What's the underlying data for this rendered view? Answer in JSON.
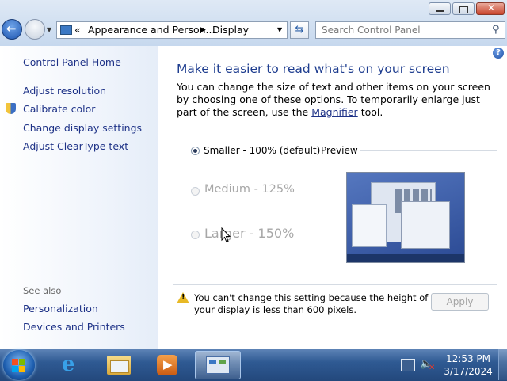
{
  "address": {
    "chevrons": "«",
    "crumb1": "Appearance and Person...",
    "separator": "▶",
    "crumb2": "Display"
  },
  "search": {
    "placeholder": "Search Control Panel"
  },
  "sidebar": {
    "home": "Control Panel Home",
    "tasks": [
      "Adjust resolution",
      "Calibrate color",
      "Change display settings",
      "Adjust ClearType text"
    ],
    "see_also_title": "See also",
    "see_also": [
      "Personalization",
      "Devices and Printers"
    ]
  },
  "main": {
    "heading": "Make it easier to read what's on your screen",
    "intro": "You can change the size of text and other items on your screen by choosing one of these options. To temporarily enlarge just part of the screen, use the",
    "magnifier_link": "Magnifier",
    "intro_tail": "tool.",
    "options": [
      {
        "label": "Smaller - 100% (default)",
        "selected": true,
        "enabled": true
      },
      {
        "label": "Medium - 125%",
        "selected": false,
        "enabled": false
      },
      {
        "label": "Larger - 150%",
        "selected": false,
        "enabled": false
      }
    ],
    "preview_label": "Preview",
    "warning": "You can't change this setting because the height of your display is less than 600 pixels.",
    "apply_label": "Apply"
  },
  "taskbar": {
    "time": "12:53 PM",
    "date": "3/17/2024"
  },
  "colors": {
    "link": "#1e3287",
    "heading": "#1e3d8f",
    "taskbar": "#2f5a93"
  }
}
